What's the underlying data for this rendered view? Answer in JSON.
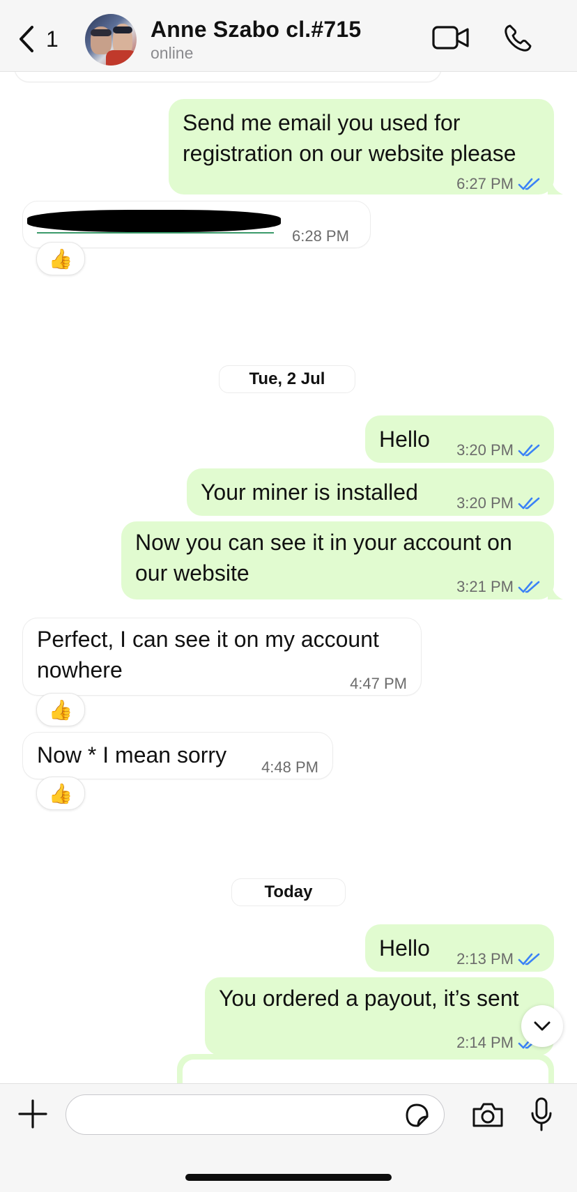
{
  "header": {
    "back_count": "1",
    "contact_name": "Anne Szabo cl.#715",
    "status": "online"
  },
  "chat": {
    "messages": [
      {
        "direction": "out",
        "text_lines": [
          "Send me email you used for",
          "registration on our website please"
        ],
        "time": "6:27 PM",
        "read": true
      },
      {
        "direction": "in",
        "text": "[redacted email]",
        "time": "6:28 PM",
        "reaction": "👍"
      },
      {
        "date_separator": "Tue, 2 Jul"
      },
      {
        "direction": "out",
        "text": "Hello",
        "time": "3:20 PM",
        "read": true
      },
      {
        "direction": "out",
        "text": "Your miner is installed",
        "time": "3:20 PM",
        "read": true
      },
      {
        "direction": "out",
        "text_lines": [
          "Now you can see it in your account on",
          "our website"
        ],
        "time": "3:21 PM",
        "read": true
      },
      {
        "direction": "in",
        "text_lines": [
          "Perfect, I can see it on my account",
          "nowhere"
        ],
        "time": "4:47 PM",
        "reaction": "👍"
      },
      {
        "direction": "in",
        "text": "Now * I mean sorry",
        "time": "4:48 PM",
        "reaction": "👍"
      },
      {
        "date_separator": "Today"
      },
      {
        "direction": "out",
        "text": "Hello",
        "time": "2:13 PM",
        "read": true
      },
      {
        "direction": "out",
        "text": "You ordered a payout, it’s sent",
        "time": "2:14 PM",
        "read": true
      }
    ]
  },
  "composer": {
    "placeholder": ""
  },
  "icons": {
    "back": "chevron-left-icon",
    "video": "video-camera-icon",
    "call": "phone-icon",
    "scroll": "chevron-down-icon",
    "attach": "plus-icon",
    "sticker": "sticker-icon",
    "camera": "camera-icon",
    "mic": "microphone-icon"
  },
  "colors": {
    "outgoing_bubble": "#e1fbd0",
    "incoming_bubble": "#ffffff",
    "read_ticks": "#3b82f6"
  }
}
